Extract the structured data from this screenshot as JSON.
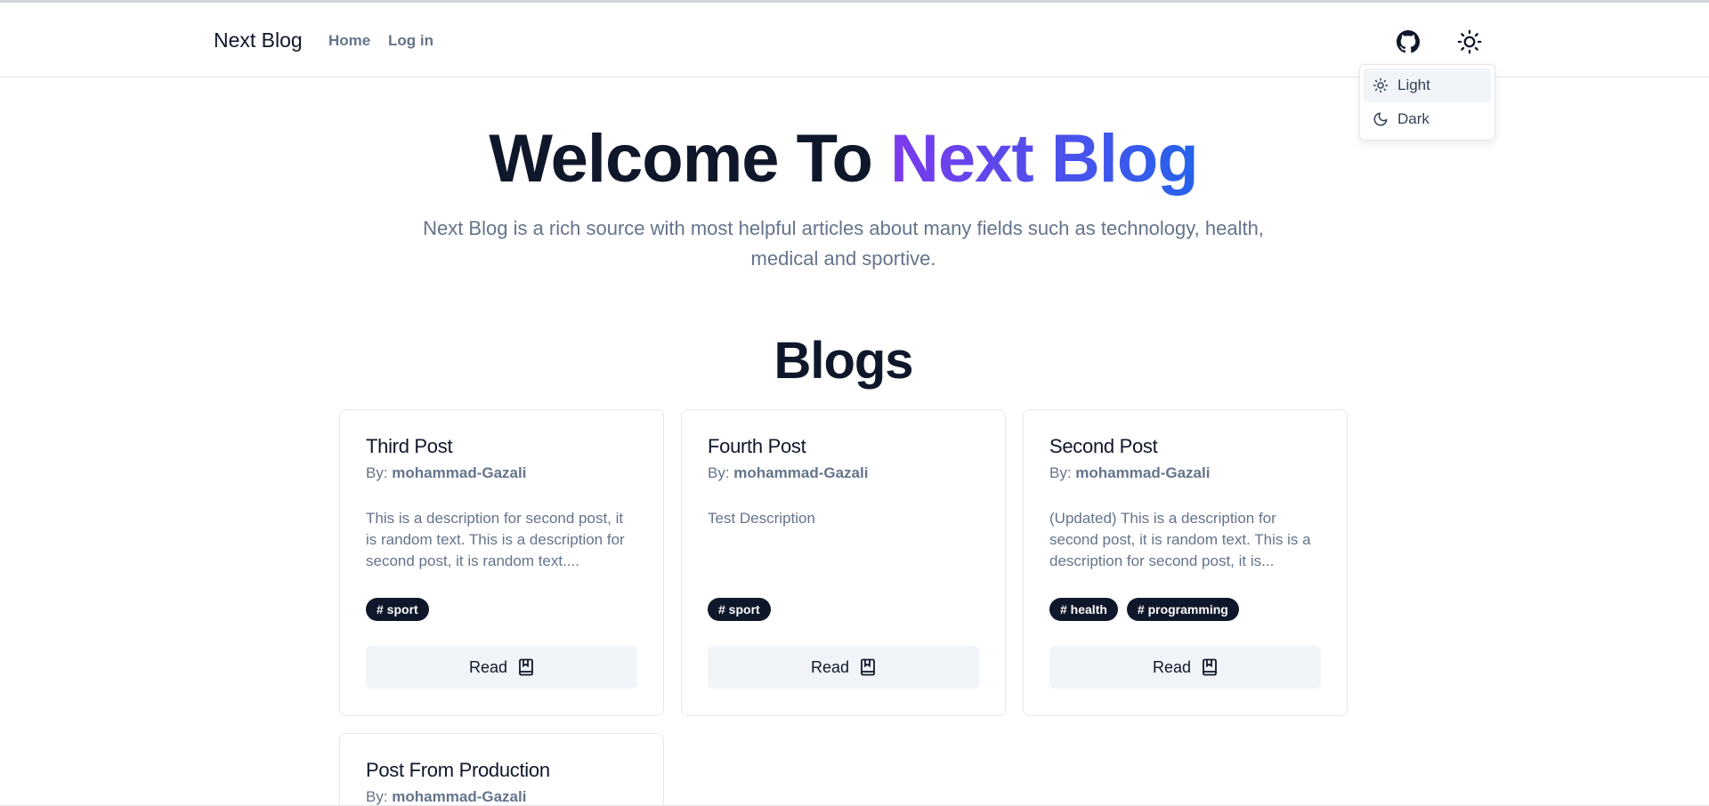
{
  "nav": {
    "brand": "Next Blog",
    "home": "Home",
    "login": "Log in"
  },
  "theme_menu": {
    "items": [
      {
        "label": "Light",
        "icon": "sun-icon",
        "active": true
      },
      {
        "label": "Dark",
        "icon": "moon-icon",
        "active": false
      }
    ]
  },
  "hero": {
    "title_part1": "Welcome To ",
    "title_part2": "Next Blog",
    "subtitle": "Next Blog is a rich source with most helpful articles about many fields such as technology, health, medical and sportive."
  },
  "blogs": {
    "heading": "Blogs",
    "author_prefix": "By: ",
    "read_label": "Read",
    "posts": [
      {
        "title": "Third Post",
        "author": "mohammad-Gazali",
        "description": "This is a description for second post, it is random text. This is a description for second post, it is random text....",
        "tags": [
          "# sport"
        ]
      },
      {
        "title": "Fourth Post",
        "author": "mohammad-Gazali",
        "description": "Test Description",
        "tags": [
          "# sport"
        ]
      },
      {
        "title": "Second Post",
        "author": "mohammad-Gazali",
        "description": "(Updated) This is a description for second post, it is random text. This is a description for second post, it is...",
        "tags": [
          "# health",
          "# programming"
        ]
      },
      {
        "title": "Post From Production",
        "author": "mohammad-Gazali",
        "description": "",
        "tags": []
      }
    ]
  },
  "colors": {
    "text_dark": "#0f172a",
    "text_muted": "#64748b",
    "gradient_start": "#7c3aed",
    "gradient_end": "#2563eb",
    "button_bg": "#f1f5f9"
  }
}
